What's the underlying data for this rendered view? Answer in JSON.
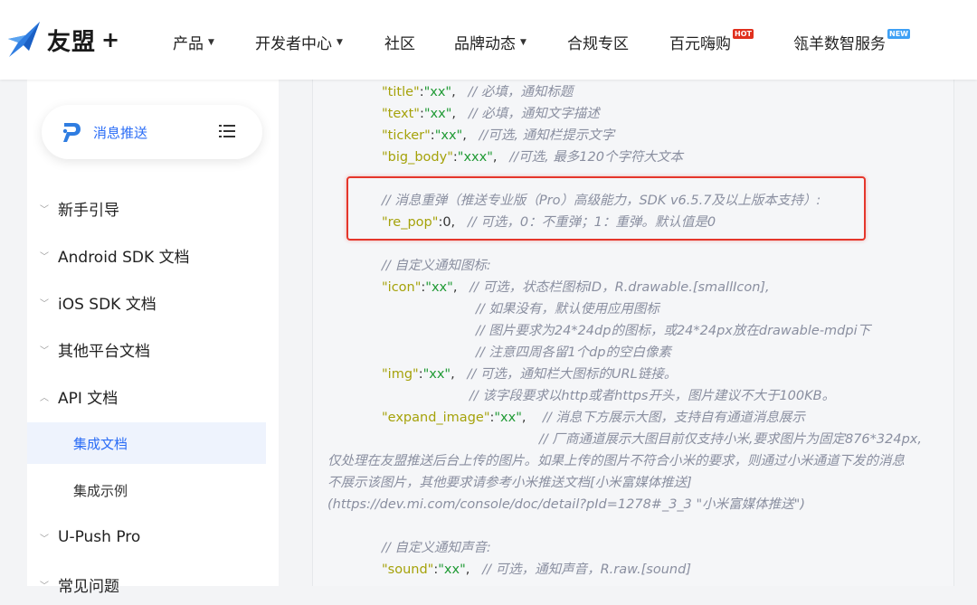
{
  "brand": {
    "name": "友盟",
    "plus": "+"
  },
  "nav": [
    {
      "label": "产品",
      "dropdown": true
    },
    {
      "label": "开发者中心",
      "dropdown": true
    },
    {
      "label": "社区",
      "dropdown": false
    },
    {
      "label": "品牌动态",
      "dropdown": true
    },
    {
      "label": "合规专区",
      "dropdown": false
    },
    {
      "label": "百元嗨购",
      "badge": "HOT"
    },
    {
      "label": "瓴羊数智服务",
      "badge": "NEW"
    }
  ],
  "sidebar": {
    "product": "消息推送",
    "items": [
      {
        "label": "新手引导",
        "expanded": false
      },
      {
        "label": "Android SDK 文档",
        "expanded": false
      },
      {
        "label": "iOS SDK 文档",
        "expanded": false
      },
      {
        "label": "其他平台文档",
        "expanded": false
      },
      {
        "label": "API 文档",
        "expanded": true
      },
      {
        "label": "U-Push Pro",
        "expanded": false
      },
      {
        "label": "常见问题",
        "expanded": false
      }
    ],
    "subitems": [
      {
        "label": "集成文档",
        "active": true
      },
      {
        "label": "集成示例",
        "active": false
      }
    ]
  },
  "code": {
    "l1": {
      "key": "\"title\"",
      "sep": ":",
      "val": "\"xx\"",
      "post": ",",
      "comment": "// 必填，通知标题"
    },
    "l2": {
      "key": "\"text\"",
      "sep": ":",
      "val": "\"xx\"",
      "post": ",",
      "comment": "// 必填，通知文字描述"
    },
    "l3": {
      "key": "\"ticker\"",
      "sep": ":",
      "val": "\"xx\"",
      "post": ",",
      "comment": "//可选, 通知栏提示文字"
    },
    "l4": {
      "key": "\"big_body\"",
      "sep": ":",
      "val": "\"xxx\"",
      "post": ",",
      "comment": "//可选, 最多120个字符大文本"
    },
    "l5": {
      "comment": "// 消息重弹（推送专业版（Pro）高级能力，SDK v6.5.7及以上版本支持）:"
    },
    "l6": {
      "key": "\"re_pop\"",
      "sep": ":",
      "val": "0,",
      "comment": "// 可选，0：不重弹；1：重弹。默认值是0"
    },
    "l7": {
      "comment": "// 自定义通知图标:"
    },
    "l8": {
      "key": "\"icon\"",
      "sep": ":",
      "val": "\"xx\"",
      "post": ",",
      "comment": "// 可选，状态栏图标ID，R.drawable.[smallIcon],"
    },
    "l9": {
      "comment": "// 如果没有，默认使用应用图标"
    },
    "l10": {
      "comment": "// 图片要求为24*24dp的图标，或24*24px放在drawable-mdpi下"
    },
    "l11": {
      "comment": "// 注意四周各留1个dp的空白像素"
    },
    "l12": {
      "key": "\"img\"",
      "sep": ":",
      "val": "\"xx\"",
      "post": ",",
      "comment": "// 可选，通知栏大图标的URL链接。"
    },
    "l13": {
      "comment": "// 该字段要求以http或者https开头，图片建议不大于100KB。"
    },
    "l14": {
      "key": "\"expand_image\"",
      "sep": ":",
      "val": "\"xx\"",
      "post": ",",
      "comment": "// 消息下方展示大图，支持自有通道消息展示"
    },
    "l15": {
      "comment": "// 厂商通道展示大图目前仅支持小米,要求图片为固定876*324px,"
    },
    "l16": {
      "comment": "仅处理在友盟推送后台上传的图片。如果上传的图片不符合小米的要求，则通过小米通道下发的消息"
    },
    "l17": {
      "comment": "不展示该图片，其他要求请参考小米推送文档[小米富媒体推送]"
    },
    "l18": {
      "comment": "(https://dev.mi.com/console/doc/detail?pId=1278#_3_3 \"小米富媒体推送\")"
    },
    "l19": {
      "comment": "// 自定义通知声音:"
    },
    "l20": {
      "key": "\"sound\"",
      "sep": ":",
      "val": "\"xx\"",
      "post": ",",
      "comment": "// 可选，通知声音，R.raw.[sound]"
    }
  }
}
